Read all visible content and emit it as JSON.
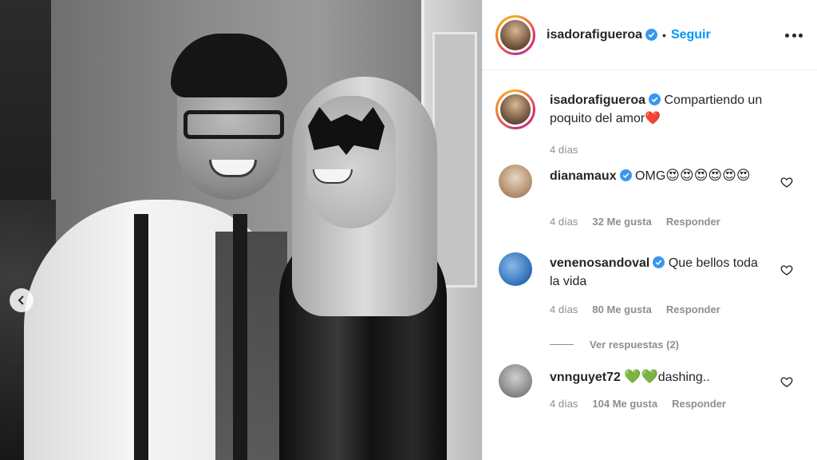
{
  "post": {
    "username": "isadorafigueroa",
    "follow_label": "Seguir",
    "separator": "•",
    "caption_text": "Compartiendo un poquito del amor",
    "caption_emoji": "❤️",
    "time": "4 días"
  },
  "comments": [
    {
      "username": "dianamaux",
      "text": "OMG",
      "emojis": "😍😍😍😍😍😍",
      "time": "4 días",
      "likes": "32 Me gusta",
      "reply_label": "Responder"
    },
    {
      "username": "venenosandoval",
      "text": "Que bellos toda la vida",
      "time": "4 días",
      "likes": "80 Me gusta",
      "reply_label": "Responder",
      "view_replies": "Ver respuestas (2)"
    },
    {
      "username": "vnnguyet72",
      "emojis": "💚💚",
      "text": "dashing..",
      "time": "4 días",
      "likes": "104 Me gusta",
      "reply_label": "Responder"
    }
  ],
  "colors": {
    "accent": "#0095f6",
    "verified": "#3897f0",
    "muted": "#8e8e8e"
  },
  "icons": [
    "chevron-left-icon",
    "verified-badge-icon",
    "more-options-icon",
    "heart-outline-icon"
  ]
}
